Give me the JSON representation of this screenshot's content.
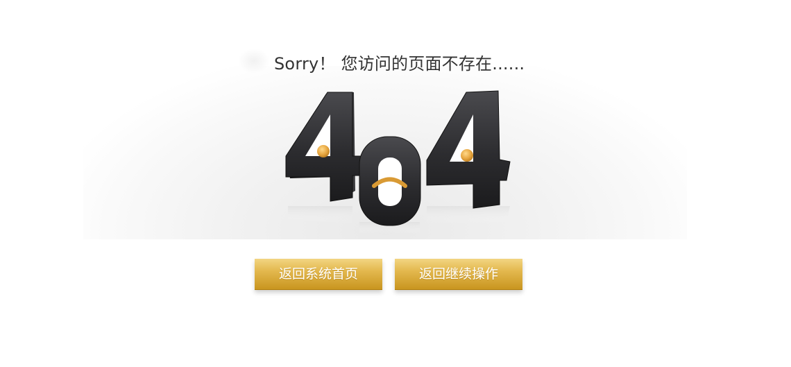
{
  "message": {
    "sorry": "Sorry！ 您访问的页面不存在......"
  },
  "illustration": {
    "digits": [
      "4",
      "0",
      "4"
    ],
    "face": "sad-face",
    "digit_color": "#2a2a2c",
    "accent_color": "#e1a33f"
  },
  "buttons": {
    "home_label": "返回系统首页",
    "back_label": "返回继续操作"
  },
  "colors": {
    "button_gold_top": "#f2d582",
    "button_gold_bottom": "#c9951f",
    "text": "#333333"
  }
}
